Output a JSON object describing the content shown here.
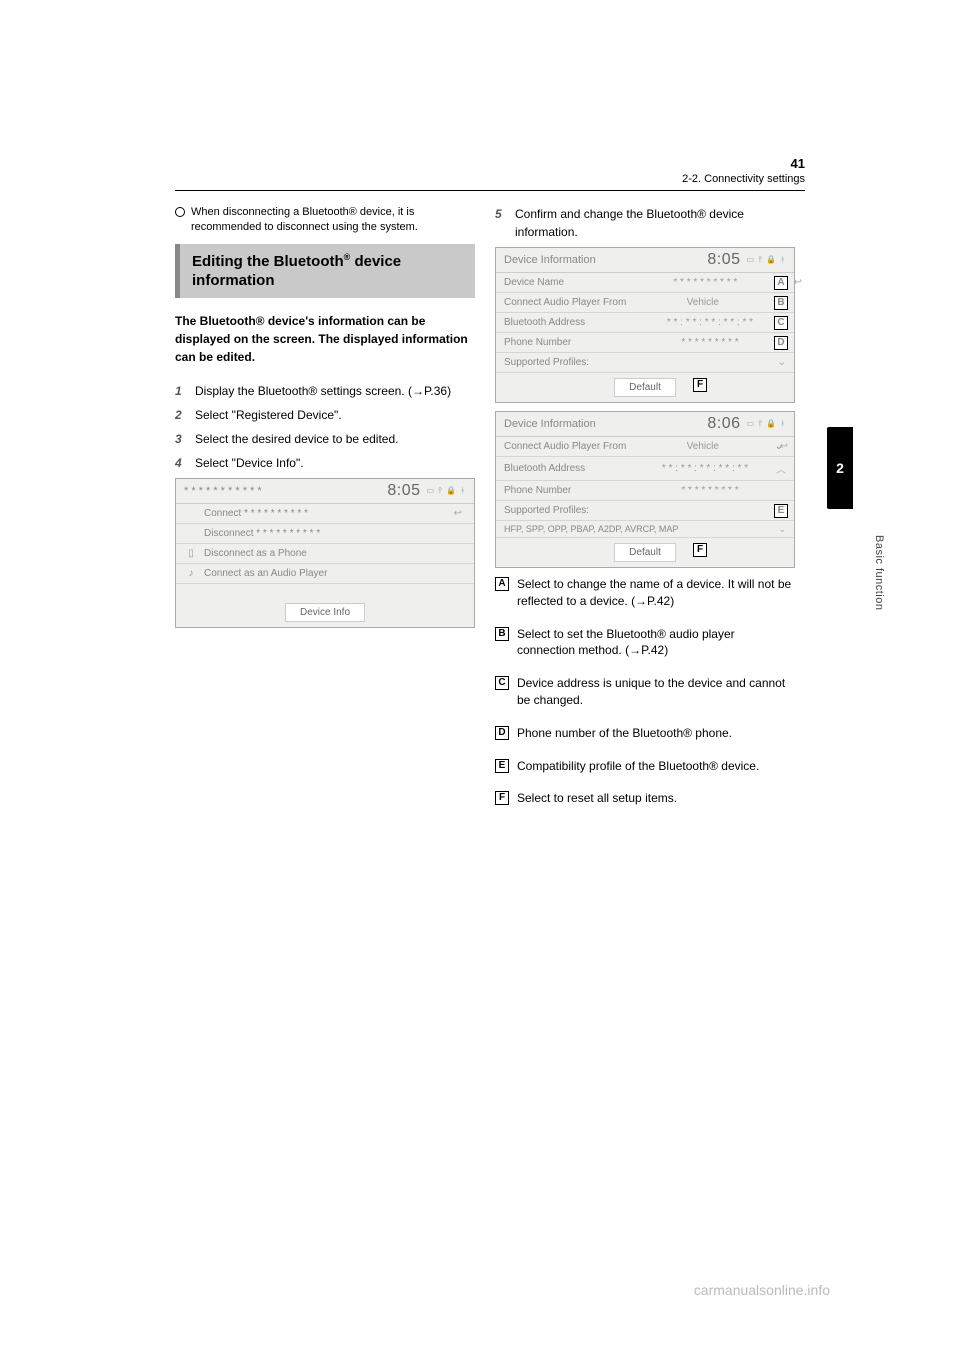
{
  "header": {
    "page_num": "41",
    "section": "2-2. Connectivity settings"
  },
  "left": {
    "bullet_text": "When disconnecting a Bluetooth® device, it is recommended to disconnect using the system.",
    "heading": "Editing the Bluetooth® device information",
    "intro": "The Bluetooth® device's information can be displayed on the screen. The displayed information can be edited.",
    "steps": [
      "Display the Bluetooth® settings screen. (→P.36)",
      "Select \"Registered Device\".",
      "Select the desired device to be edited.",
      "Select \"Device Info\"."
    ],
    "shot1": {
      "title_dots": "* * * * * * * * * * *",
      "time": "8:05",
      "rows": {
        "connect": "Connect  * * * * * * * * * *",
        "disconnect": "Disconnect  * * * * * * * * * *",
        "disc_phone": "Disconnect as a Phone",
        "conn_audio": "Connect as an Audio Player"
      },
      "button": "Device Info"
    }
  },
  "right": {
    "step5": "Confirm and change the Bluetooth® device information.",
    "shot2": {
      "title": "Device Information",
      "time": "8:05",
      "rows": {
        "dev_name": "Device Name",
        "dev_name_val": "* * * * * * * * * *",
        "connect_from": "Connect Audio Player From",
        "connect_from_val": "Vehicle",
        "bt_addr": "Bluetooth Address",
        "bt_addr_val": "* * : * * : * * : * * : * *",
        "phone": "Phone Number",
        "phone_val": "* * * * * * * * *",
        "profiles": "Supported Profiles:"
      },
      "button": "Default"
    },
    "shot3": {
      "title": "Device Information",
      "time": "8:06",
      "rows": {
        "connect_from": "Connect Audio Player From",
        "connect_from_val": "Vehicle",
        "bt_addr": "Bluetooth Address",
        "bt_addr_val": "* * : * * : * * : * * : * *",
        "phone": "Phone Number",
        "phone_val": "* * * * * * * * *",
        "profiles": "Supported Profiles:",
        "profiles_list": "HFP, SPP, OPP, PBAP, A2DP, AVRCP, MAP"
      },
      "button": "Default"
    },
    "labels": {
      "A": "A",
      "B": "B",
      "C": "C",
      "D": "D",
      "E": "E",
      "F": "F"
    },
    "descriptions": {
      "A": "Select to change the name of a device. It will not be reflected to a device. (→P.42)",
      "B": "Select to set the Bluetooth® audio player connection method. (→P.42)",
      "C": "Device address is unique to the device and cannot be changed.",
      "D": "Phone number of the Bluetooth® phone.",
      "E": "Compatibility profile of the Bluetooth® device.",
      "F": "Select to reset all setup items."
    }
  },
  "sidetab": "2",
  "sidelabel": "Basic function",
  "footer": "carmanualsonline.info"
}
